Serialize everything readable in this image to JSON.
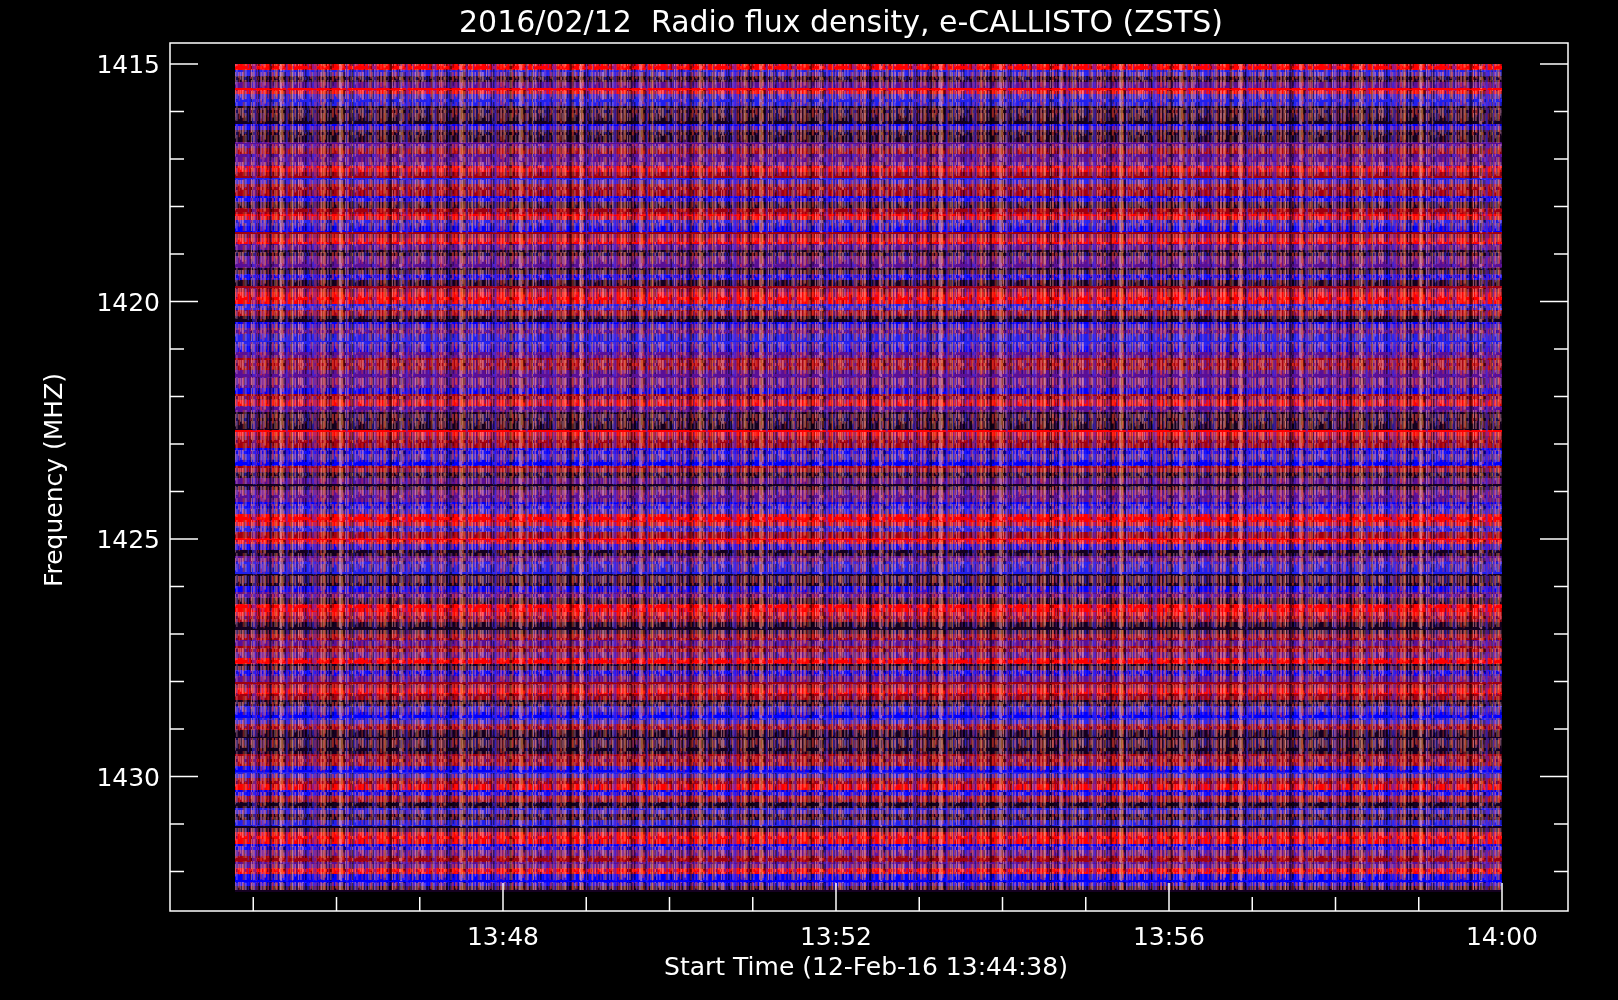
{
  "plot": {
    "title": "2016/02/12  Radio flux density, e-CALLISTO (ZSTS)",
    "ylabel": "Frequency (MHZ)",
    "xlabel": "Start Time (12-Feb-16 13:44:38)",
    "yticks": [
      "1415",
      "1420",
      "1425",
      "1430"
    ],
    "xticks": [
      "13:48",
      "13:52",
      "13:56",
      "14:00"
    ]
  }
}
